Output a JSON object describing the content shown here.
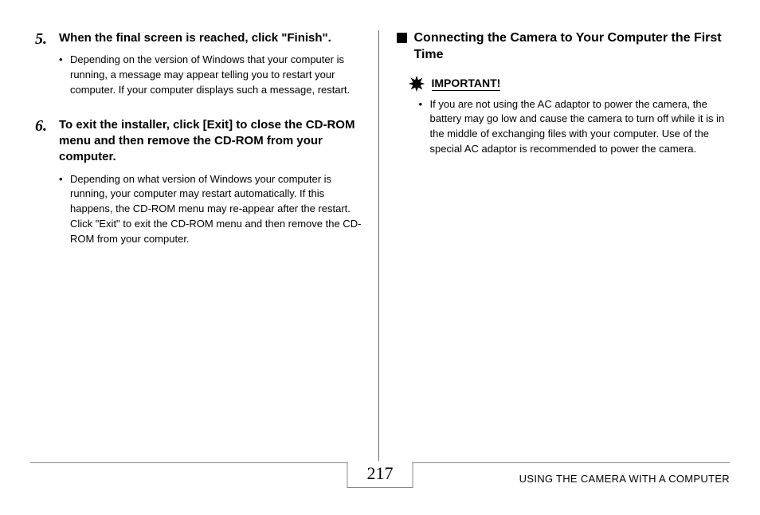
{
  "left": {
    "steps": [
      {
        "num": "5.",
        "title": "When the final screen is reached, click \"Finish\".",
        "note": "Depending on the version of Windows that your computer is running, a message may appear telling you to restart your computer. If your computer displays such a message, restart."
      },
      {
        "num": "6.",
        "title": "To exit the installer, click [Exit] to close the CD-ROM menu and then remove the CD-ROM from your computer.",
        "note": "Depending on what version of Windows your computer is running, your computer may restart automatically. If this happens, the CD-ROM menu may re-appear after the restart. Click \"Exit\" to exit the CD-ROM menu and then remove the CD-ROM from your computer."
      }
    ]
  },
  "right": {
    "section_title": "Connecting the Camera to Your Computer the First Time",
    "important_label": "IMPORTANT!",
    "important_note": "If you are not using the AC adaptor to power the camera, the battery may go low and cause the camera to turn off while it is in the middle of exchanging files with your computer. Use of the special AC adaptor is recommended to power the camera."
  },
  "footer": {
    "page_number": "217",
    "section": "USING THE CAMERA WITH A COMPUTER"
  }
}
